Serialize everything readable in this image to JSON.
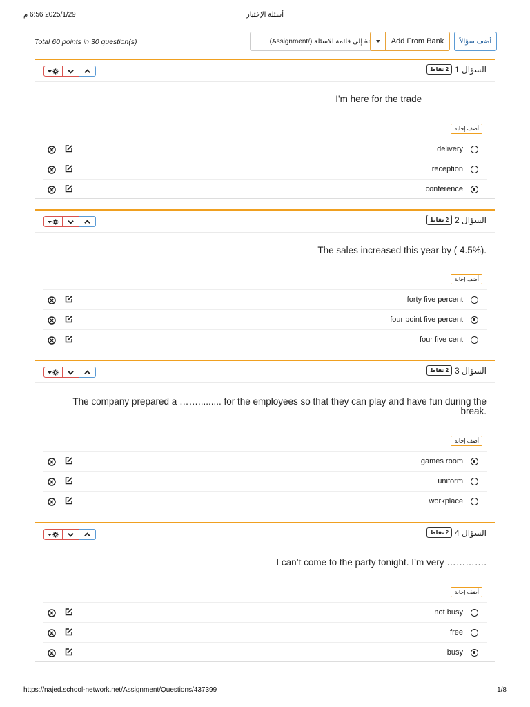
{
  "print_header": {
    "datetime": "2025/1/29 6:56 م",
    "title": "أسئلة الإختبار"
  },
  "print_footer": {
    "url": "https://najed.school-network.net/Assignment/Questions/437399",
    "page": "1/8"
  },
  "toolbar": {
    "total_text": "Total 60 points in 30 question(s)",
    "back_label": "العودة إلى قائمة الاسئلة (/Assignment)",
    "add_from_bank_label": "Add From Bank",
    "add_question_label": "أضف سؤالاً"
  },
  "add_answer_label": "أضف إجابة",
  "questions": [
    {
      "label": "السؤال 1",
      "points": "2 نقاط",
      "text": "I'm here for the trade ____________",
      "options": [
        {
          "text": "delivery",
          "selected": false
        },
        {
          "text": "reception",
          "selected": false
        },
        {
          "text": "conference",
          "selected": true
        }
      ]
    },
    {
      "label": "السؤال 2",
      "points": "2 نقاط",
      "text": "The sales increased this year by ( 4.5%).",
      "options": [
        {
          "text": "forty five percent",
          "selected": false
        },
        {
          "text": "four point five percent",
          "selected": true
        },
        {
          "text": "four five cent",
          "selected": false
        }
      ]
    },
    {
      "label": "السؤال 3",
      "points": "2 نقاط",
      "text": "The company prepared a ……......... for the employees so that they can play and have fun during the break.",
      "options": [
        {
          "text": "games room",
          "selected": true
        },
        {
          "text": "uniform",
          "selected": false
        },
        {
          "text": "workplace",
          "selected": false
        }
      ]
    },
    {
      "label": "السؤال 4",
      "points": "2 نقاط",
      "text": "I can’t come to the party tonight. I’m very ………….",
      "options": [
        {
          "text": "not busy",
          "selected": false
        },
        {
          "text": "free",
          "selected": false
        },
        {
          "text": "busy",
          "selected": true
        }
      ]
    }
  ],
  "colors": {
    "card_accent": "#f0a020",
    "danger": "#d9534f",
    "primary": "#5b9bd5"
  },
  "icons": [
    "gear-icon",
    "chevron-down-icon",
    "chevron-up-icon",
    "delete-circle-icon",
    "edit-icon",
    "caret-down-icon"
  ]
}
